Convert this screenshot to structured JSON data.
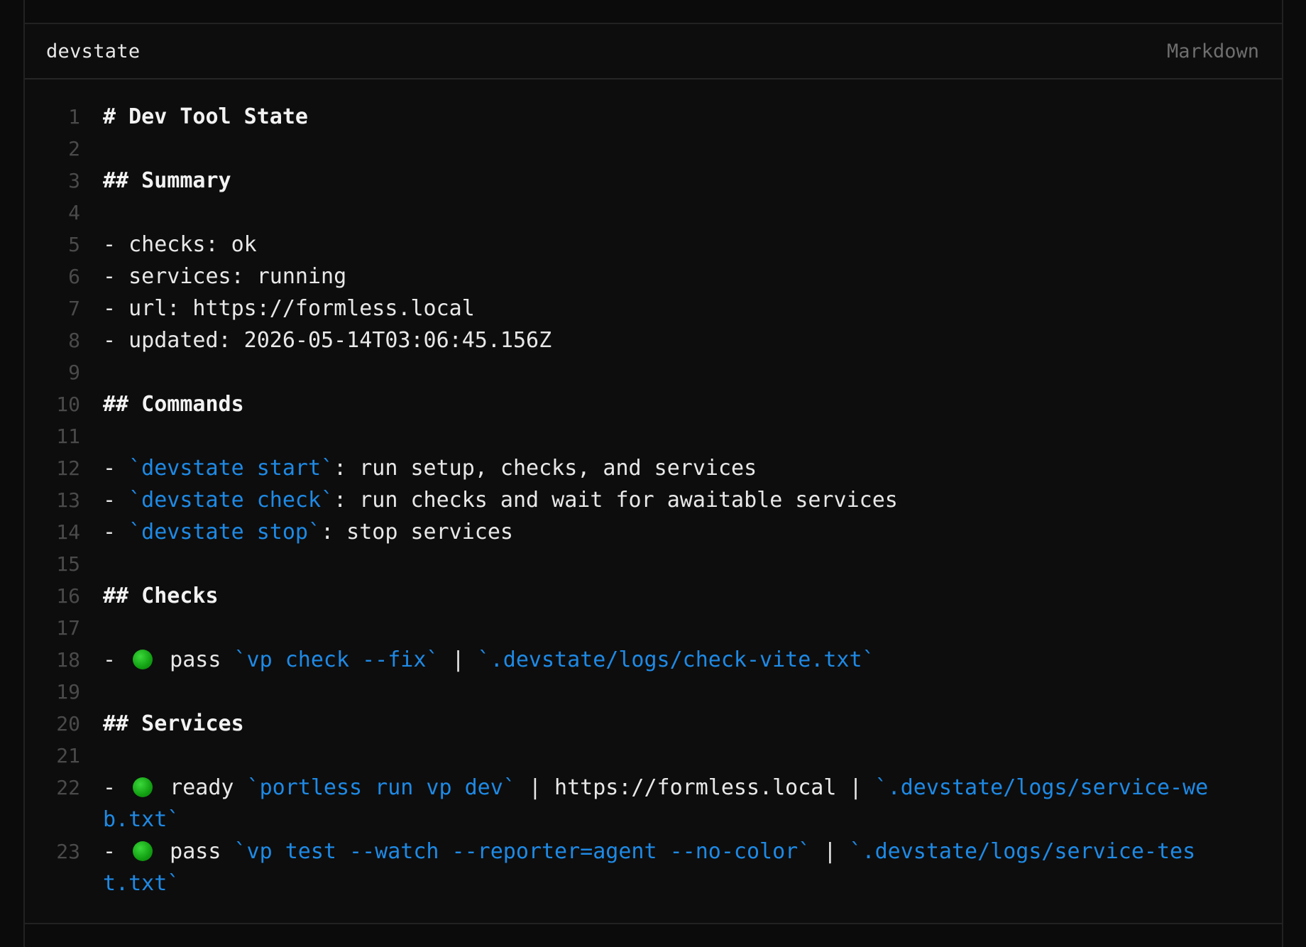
{
  "editor": {
    "filename": "devstate",
    "language": "Markdown"
  },
  "lines": {
    "1": {
      "n": "1",
      "text": "# Dev Tool State"
    },
    "2": {
      "n": "2"
    },
    "3": {
      "n": "3",
      "text": "## Summary"
    },
    "4": {
      "n": "4"
    },
    "5": {
      "n": "5",
      "text": "- checks: ok"
    },
    "6": {
      "n": "6",
      "text": "- services: running"
    },
    "7": {
      "n": "7",
      "text": "- url: https://formless.local"
    },
    "8": {
      "n": "8",
      "text": "- updated: 2026-05-14T03:06:45.156Z"
    },
    "9": {
      "n": "9"
    },
    "10": {
      "n": "10",
      "text": "## Commands"
    },
    "11": {
      "n": "11"
    },
    "12": {
      "n": "12",
      "prefix": "- ",
      "code": "`devstate start`",
      "rest": ": run setup, checks, and services"
    },
    "13": {
      "n": "13",
      "prefix": "- ",
      "code": "`devstate check`",
      "rest": ": run checks and wait for awaitable services"
    },
    "14": {
      "n": "14",
      "prefix": "- ",
      "code": "`devstate stop`",
      "rest": ": stop services"
    },
    "15": {
      "n": "15"
    },
    "16": {
      "n": "16",
      "text": "## Checks"
    },
    "17": {
      "n": "17"
    },
    "18": {
      "n": "18",
      "prefix": "- ",
      "status_icon": "green-circle",
      "status": " pass ",
      "code1": "`vp check --fix`",
      "sep1": " | ",
      "code2": "`.devstate/logs/check-vite.txt`"
    },
    "19": {
      "n": "19"
    },
    "20": {
      "n": "20",
      "text": "## Services"
    },
    "21": {
      "n": "21"
    },
    "22": {
      "n": "22",
      "prefix": "- ",
      "status_icon": "green-circle",
      "status": " ready ",
      "code1": "`portless run vp dev`",
      "sep1": " | https://formless.local | ",
      "code2": "`.devstate/logs/service-web.txt`"
    },
    "23": {
      "n": "23",
      "prefix": "- ",
      "status_icon": "green-circle",
      "status": " pass ",
      "code1": "`vp test --watch --reporter=agent --no-color`",
      "sep1": " | ",
      "code2": "`.devstate/logs/service-test.txt`"
    }
  },
  "colors": {
    "background": "#0d0d0d",
    "text": "#e8e8e8",
    "line_number": "#4a4a4a",
    "inline_code": "#1e8ae6",
    "status_ok": "#12a012"
  }
}
